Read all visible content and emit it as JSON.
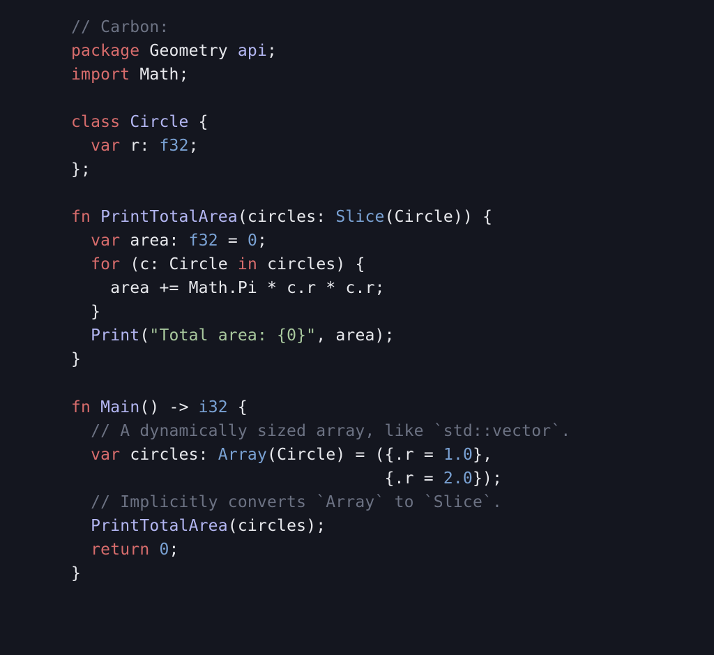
{
  "code": {
    "tokens": [
      [
        {
          "c": "cmt",
          "t": "// Carbon:"
        }
      ],
      [
        {
          "c": "kw",
          "t": "package"
        },
        {
          "c": "op",
          "t": " "
        },
        {
          "c": "nm",
          "t": "Geometry"
        },
        {
          "c": "op",
          "t": " "
        },
        {
          "c": "api",
          "t": "api"
        },
        {
          "c": "op",
          "t": ";"
        }
      ],
      [
        {
          "c": "kw",
          "t": "import"
        },
        {
          "c": "op",
          "t": " "
        },
        {
          "c": "nm",
          "t": "Math"
        },
        {
          "c": "op",
          "t": ";"
        }
      ],
      [],
      [
        {
          "c": "kw",
          "t": "class"
        },
        {
          "c": "op",
          "t": " "
        },
        {
          "c": "cls",
          "t": "Circle"
        },
        {
          "c": "op",
          "t": " {"
        }
      ],
      [
        {
          "c": "op",
          "t": "  "
        },
        {
          "c": "kw",
          "t": "var"
        },
        {
          "c": "op",
          "t": " "
        },
        {
          "c": "nm",
          "t": "r"
        },
        {
          "c": "op",
          "t": ": "
        },
        {
          "c": "typ",
          "t": "f32"
        },
        {
          "c": "op",
          "t": ";"
        }
      ],
      [
        {
          "c": "op",
          "t": "};"
        }
      ],
      [],
      [
        {
          "c": "kw2",
          "t": "fn"
        },
        {
          "c": "op",
          "t": " "
        },
        {
          "c": "cls",
          "t": "PrintTotalArea"
        },
        {
          "c": "op",
          "t": "("
        },
        {
          "c": "nm",
          "t": "circles"
        },
        {
          "c": "op",
          "t": ": "
        },
        {
          "c": "typ",
          "t": "Slice"
        },
        {
          "c": "op",
          "t": "("
        },
        {
          "c": "nm",
          "t": "Circle"
        },
        {
          "c": "op",
          "t": ")) {"
        }
      ],
      [
        {
          "c": "op",
          "t": "  "
        },
        {
          "c": "kw",
          "t": "var"
        },
        {
          "c": "op",
          "t": " "
        },
        {
          "c": "nm",
          "t": "area"
        },
        {
          "c": "op",
          "t": ": "
        },
        {
          "c": "typ",
          "t": "f32"
        },
        {
          "c": "op",
          "t": " = "
        },
        {
          "c": "num",
          "t": "0"
        },
        {
          "c": "op",
          "t": ";"
        }
      ],
      [
        {
          "c": "op",
          "t": "  "
        },
        {
          "c": "kw",
          "t": "for"
        },
        {
          "c": "op",
          "t": " ("
        },
        {
          "c": "nm",
          "t": "c"
        },
        {
          "c": "op",
          "t": ": "
        },
        {
          "c": "nm",
          "t": "Circle"
        },
        {
          "c": "op",
          "t": " "
        },
        {
          "c": "kw",
          "t": "in"
        },
        {
          "c": "op",
          "t": " "
        },
        {
          "c": "nm",
          "t": "circles"
        },
        {
          "c": "op",
          "t": ") {"
        }
      ],
      [
        {
          "c": "op",
          "t": "    "
        },
        {
          "c": "nm",
          "t": "area"
        },
        {
          "c": "op",
          "t": " += "
        },
        {
          "c": "nm",
          "t": "Math"
        },
        {
          "c": "op",
          "t": "."
        },
        {
          "c": "nm",
          "t": "Pi"
        },
        {
          "c": "op",
          "t": " * "
        },
        {
          "c": "nm",
          "t": "c"
        },
        {
          "c": "op",
          "t": "."
        },
        {
          "c": "nm",
          "t": "r"
        },
        {
          "c": "op",
          "t": " * "
        },
        {
          "c": "nm",
          "t": "c"
        },
        {
          "c": "op",
          "t": "."
        },
        {
          "c": "nm",
          "t": "r"
        },
        {
          "c": "op",
          "t": ";"
        }
      ],
      [
        {
          "c": "op",
          "t": "  }"
        }
      ],
      [
        {
          "c": "op",
          "t": "  "
        },
        {
          "c": "cls",
          "t": "Print"
        },
        {
          "c": "op",
          "t": "("
        },
        {
          "c": "str",
          "t": "\"Total area: {0}\""
        },
        {
          "c": "op",
          "t": ", "
        },
        {
          "c": "nm",
          "t": "area"
        },
        {
          "c": "op",
          "t": ");"
        }
      ],
      [
        {
          "c": "op",
          "t": "}"
        }
      ],
      [],
      [
        {
          "c": "kw2",
          "t": "fn"
        },
        {
          "c": "op",
          "t": " "
        },
        {
          "c": "cls",
          "t": "Main"
        },
        {
          "c": "op",
          "t": "() -> "
        },
        {
          "c": "typ",
          "t": "i32"
        },
        {
          "c": "op",
          "t": " {"
        }
      ],
      [
        {
          "c": "op",
          "t": "  "
        },
        {
          "c": "cmt",
          "t": "// A dynamically sized array, like `std::vector`."
        }
      ],
      [
        {
          "c": "op",
          "t": "  "
        },
        {
          "c": "kw",
          "t": "var"
        },
        {
          "c": "op",
          "t": " "
        },
        {
          "c": "nm",
          "t": "circles"
        },
        {
          "c": "op",
          "t": ": "
        },
        {
          "c": "typ",
          "t": "Array"
        },
        {
          "c": "op",
          "t": "("
        },
        {
          "c": "nm",
          "t": "Circle"
        },
        {
          "c": "op",
          "t": ") = ({."
        },
        {
          "c": "nm",
          "t": "r"
        },
        {
          "c": "op",
          "t": " = "
        },
        {
          "c": "num",
          "t": "1.0"
        },
        {
          "c": "op",
          "t": "},"
        }
      ],
      [
        {
          "c": "op",
          "t": "                                {."
        },
        {
          "c": "nm",
          "t": "r"
        },
        {
          "c": "op",
          "t": " = "
        },
        {
          "c": "num",
          "t": "2.0"
        },
        {
          "c": "op",
          "t": "});"
        }
      ],
      [
        {
          "c": "op",
          "t": "  "
        },
        {
          "c": "cmt",
          "t": "// Implicitly converts `Array` to `Slice`."
        }
      ],
      [
        {
          "c": "op",
          "t": "  "
        },
        {
          "c": "cls",
          "t": "PrintTotalArea"
        },
        {
          "c": "op",
          "t": "("
        },
        {
          "c": "nm",
          "t": "circles"
        },
        {
          "c": "op",
          "t": ");"
        }
      ],
      [
        {
          "c": "op",
          "t": "  "
        },
        {
          "c": "kw",
          "t": "return"
        },
        {
          "c": "op",
          "t": " "
        },
        {
          "c": "num",
          "t": "0"
        },
        {
          "c": "op",
          "t": ";"
        }
      ],
      [
        {
          "c": "op",
          "t": "}"
        }
      ]
    ]
  }
}
